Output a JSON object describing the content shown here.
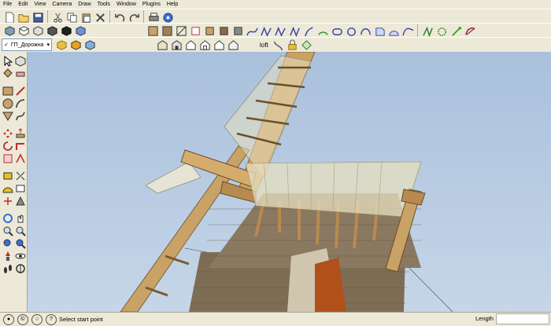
{
  "menu": [
    "File",
    "Edit",
    "View",
    "Camera",
    "Draw",
    "Tools",
    "Window",
    "Plugins",
    "Help"
  ],
  "layer": {
    "name": "ГП_Дорожна",
    "checked": "✓"
  },
  "toolbar2": {
    "loft_label": "loft"
  },
  "status": {
    "prompt": "Select start point",
    "measurements_label": "Length",
    "measurements_value": ""
  },
  "colors": {
    "chrome": "#ece9d8",
    "sky_top": "#a9c0dc",
    "sky_bottom": "#c6d6e8",
    "wood": "#c9a266",
    "roof": "#7e6d55",
    "sail": "#e6dfc0"
  },
  "icons": {
    "standard": [
      "new-icon",
      "open-icon",
      "save-icon",
      "cut-icon",
      "copy-icon",
      "paste-icon",
      "erase-icon",
      "undo-icon",
      "redo-icon",
      "print-icon",
      "model-info-icon"
    ],
    "views": [
      "iso-view-icon",
      "top-view-icon",
      "front-view-icon",
      "right-view-icon",
      "back-view-icon",
      "left-view-icon"
    ],
    "styles": [
      "xray-icon",
      "back-edges-icon",
      "wireframe-icon",
      "hidden-line-icon",
      "shaded-icon",
      "textured-icon",
      "monochrome-icon"
    ],
    "sandbox": [
      "from-contours-icon",
      "from-scratch-icon",
      "smoove-icon",
      "stamp-icon",
      "drape-icon",
      "add-detail-icon",
      "flip-edge-icon"
    ],
    "curves": [
      "bezier-icon",
      "polyline-icon",
      "spline-icon",
      "catmull-icon",
      "cubic-bezier-icon",
      "arc-icon",
      "rounded-rect-icon",
      "circle-curve-icon",
      "ellipse-icon",
      "blob-icon",
      "segment-icon",
      "wave-icon",
      "spiral-icon",
      "star-icon",
      "polygon-icon",
      "leaf-icon"
    ],
    "sections": [
      "section-plane-icon",
      "display-sections-icon",
      "house-icon",
      "house-outline-icon",
      "house-door-icon",
      "house-empty-icon"
    ],
    "loft": [
      "curviloft-icon",
      "lock-icon",
      "weld-icon"
    ]
  }
}
